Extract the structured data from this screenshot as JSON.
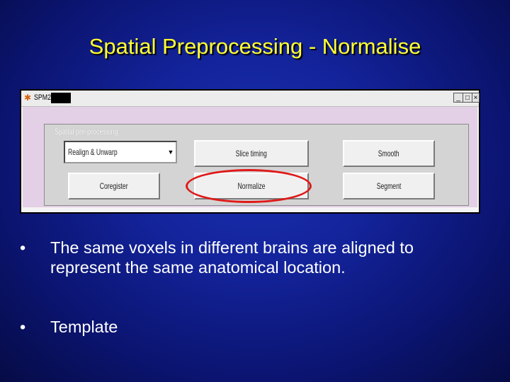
{
  "slide": {
    "title": "Spatial Preprocessing - Normalise",
    "bullets": [
      "The same voxels in different brains are aligned to represent the same anatomical location.",
      "Template"
    ],
    "bullet_symbol": "•"
  },
  "window": {
    "app_name": "SPM2",
    "controls": {
      "minimize": "_",
      "maximize": "□",
      "close": "×"
    },
    "panel_label": "Spatial pre-processing",
    "dropdown": {
      "selected": "Realign & Unwarp"
    },
    "buttons": {
      "slice_timing": "Slice timing",
      "smooth": "Smooth",
      "coregister": "Coregister",
      "normalize": "Normalize",
      "segment": "Segment"
    }
  },
  "colors": {
    "title": "#ffff33",
    "bullet_text": "#ffffff",
    "highlight": "#e01818",
    "panel_bg": "#e3cfe6",
    "background": "#13239a"
  }
}
